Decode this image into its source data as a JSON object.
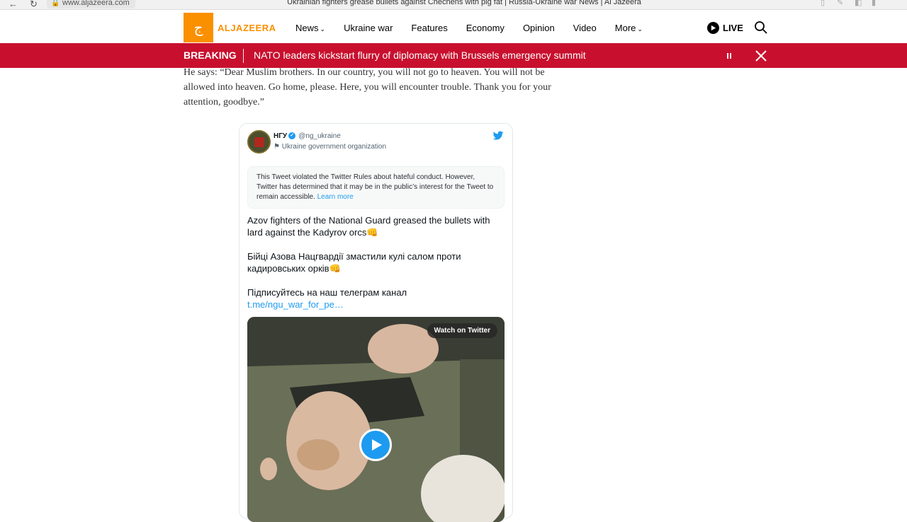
{
  "browser": {
    "url": "www.aljazeera.com",
    "tab_title": "Ukrainian fighters grease bullets against Chechens with pig fat | Russia-Ukraine war News | Al Jazeera"
  },
  "header": {
    "logo_text": "ALJAZEERA",
    "nav": [
      {
        "label": "News",
        "dropdown": true
      },
      {
        "label": "Ukraine war",
        "dropdown": false
      },
      {
        "label": "Features",
        "dropdown": false
      },
      {
        "label": "Economy",
        "dropdown": false
      },
      {
        "label": "Opinion",
        "dropdown": false
      },
      {
        "label": "Video",
        "dropdown": false
      },
      {
        "label": "More",
        "dropdown": true
      }
    ],
    "live_label": "LIVE"
  },
  "breaking": {
    "label": "BREAKING",
    "headline": "NATO leaders kickstart flurry of diplomacy with Brussels emergency summit"
  },
  "article": {
    "paragraph": "He says: “Dear Muslim brothers. In our country, you will not go to heaven. You will not be allowed into heaven. Go home, please. Here, you will encounter trouble. Thank you for your attention, goodbye.”"
  },
  "tweet": {
    "name": "НГУ",
    "handle": "@ng_ukraine",
    "org_label": "Ukraine government organization",
    "notice_text": "This Tweet violated the Twitter Rules about hateful conduct. However, Twitter has determined that it may be in the public’s interest for the Tweet to remain accessible.",
    "notice_link": "Learn more",
    "text_en": "Azov fighters of the National Guard greased the bullets with lard against the Kadyrov orcs👊",
    "text_uk": "Бійці Азова Нацгвардії змастили кулі салом проти кадировських орків👊",
    "text_sub": "Підписуйтесь на наш телеграм канал",
    "link": "t.me/ngu_war_for_pe…",
    "watch_label": "Watch on Twitter"
  },
  "colors": {
    "brand_orange": "#fa9000",
    "breaking_red": "#c8102e",
    "twitter_blue": "#1d9bf0"
  }
}
